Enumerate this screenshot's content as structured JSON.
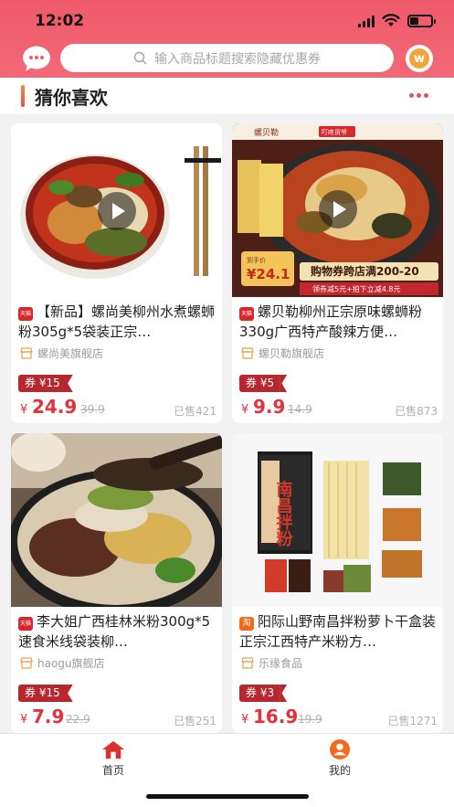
{
  "status": {
    "time": "12:02"
  },
  "header": {
    "search_placeholder": "输入商品标题搜索隐藏优惠券",
    "w_badge": "w",
    "accent": "#ef5a6b"
  },
  "section": {
    "title": "猜你喜欢"
  },
  "products": [
    {
      "tag": "天猫",
      "title": "【新品】螺尚美柳州水煮螺蛳粉305g*5袋装正宗…",
      "shop": "螺尚美旗舰店",
      "coupon": "券 ¥15",
      "price_symbol": "¥",
      "price": "24.9",
      "original_price": "39.9",
      "sold": "已售421",
      "has_video": true
    },
    {
      "tag": "天猫",
      "title": "螺贝勒柳州正宗原味螺蛳粉330g广西特产酸辣方便…",
      "shop": "螺贝勒旗舰店",
      "coupon": "券 ¥5",
      "price_symbol": "¥",
      "price": "9.9",
      "original_price": "14.9",
      "sold": "已售873",
      "has_video": true,
      "image_text": {
        "brand": "螺贝勒",
        "badge": "叮咚货爷",
        "banner": "购物券跨店满200-20",
        "banner_sub": "领券减5元+拍下立减4.8元",
        "price_tag": "¥24.1",
        "price_label": "到手价"
      }
    },
    {
      "tag": "天猫",
      "title": "李大姐广西桂林米粉300g*5速食米线袋装柳…",
      "shop": "haogu旗舰店",
      "coupon": "券 ¥15",
      "price_symbol": "¥",
      "price": "7.9",
      "original_price": "22.9",
      "sold": "已售251",
      "has_video": false
    },
    {
      "tag": "淘",
      "title": "阳际山野南昌拌粉萝卜干盒装正宗江西特产米粉方…",
      "shop": "乐缘食品",
      "coupon": "券 ¥3",
      "price_symbol": "¥",
      "price": "16.9",
      "original_price": "19.9",
      "sold": "已售1271",
      "has_video": false,
      "image_text": {
        "package": "南昌拌粉"
      }
    }
  ],
  "tabbar": {
    "home_label": "首页",
    "mine_label": "我的"
  }
}
